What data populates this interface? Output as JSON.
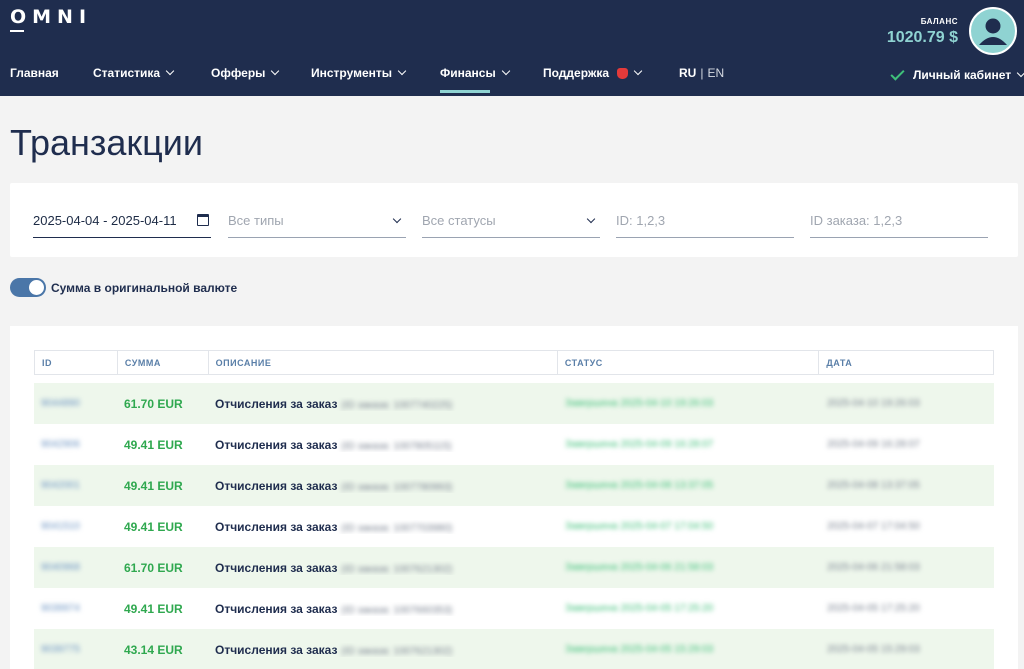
{
  "header": {
    "logo": "OMNI",
    "balance_label": "БАЛАНС",
    "balance_value": "1020.79 $",
    "avatar_icon": "user-icon"
  },
  "nav": {
    "items": [
      {
        "label": "Главная",
        "dropdown": false
      },
      {
        "label": "Статистика",
        "dropdown": true
      },
      {
        "label": "Офферы",
        "dropdown": true
      },
      {
        "label": "Инструменты",
        "dropdown": true
      },
      {
        "label": "Финансы",
        "dropdown": true,
        "active": true
      },
      {
        "label": "Поддержка",
        "dropdown": true,
        "icon": "notification-bell-icon"
      }
    ],
    "lang_ru": "RU",
    "lang_sep": "|",
    "lang_en": "EN",
    "account_label": "Личный кабинет"
  },
  "page": {
    "title": "Транзакции"
  },
  "filters": {
    "date_range": "2025-04-04 - 2025-04-11",
    "type_placeholder": "Все типы",
    "status_placeholder": "Все статусы",
    "id_placeholder": "ID: 1,2,3",
    "order_id_placeholder": "ID заказа: 1,2,3"
  },
  "toggle": {
    "label": "Сумма в оригинальной валюте",
    "on": true
  },
  "table": {
    "headers": [
      "ID",
      "СУММА",
      "ОПИСАНИЕ",
      "СТАТУС",
      "ДАТА"
    ],
    "rows": [
      {
        "id": "9044890",
        "sum": "61.70 EUR",
        "desc": "Отчисления за заказ",
        "desc_extra": "(ID заказа: 1007740225)",
        "status": "Завершена 2025-04-10 19:26:03",
        "date": "2025-04-10 19:26:03"
      },
      {
        "id": "9042906",
        "sum": "49.41 EUR",
        "desc": "Отчисления за заказ",
        "desc_extra": "(ID заказа: 1007805115)",
        "status": "Завершена 2025-04-09 16:28:07",
        "date": "2025-04-09 16:28:07"
      },
      {
        "id": "9042001",
        "sum": "49.41 EUR",
        "desc": "Отчисления за заказ",
        "desc_extra": "(ID заказа: 1007780993)",
        "status": "Завершена 2025-04-08 13:37:05",
        "date": "2025-04-08 13:37:05"
      },
      {
        "id": "9041510",
        "sum": "49.41 EUR",
        "desc": "Отчисления за заказ",
        "desc_extra": "(ID заказа: 1007703980)",
        "status": "Завершена 2025-04-07 17:04:50",
        "date": "2025-04-07 17:04:50"
      },
      {
        "id": "9040968",
        "sum": "61.70 EUR",
        "desc": "Отчисления за заказ",
        "desc_extra": "(ID заказа: 1007621302)",
        "status": "Завершена 2025-04-06 21:58:03",
        "date": "2025-04-06 21:58:03"
      },
      {
        "id": "9039974",
        "sum": "49.41 EUR",
        "desc": "Отчисления за заказ",
        "desc_extra": "(ID заказа: 1007660353)",
        "status": "Завершена 2025-04-05 17:25:20",
        "date": "2025-04-05 17:25:20"
      },
      {
        "id": "9039775",
        "sum": "43.14 EUR",
        "desc": "Отчисления за заказ",
        "desc_extra": "(ID заказа: 1007621302)",
        "status": "Завершена 2025-04-05 15:29:03",
        "date": "2025-04-05 15:29:03"
      }
    ]
  },
  "colors": {
    "header_bg": "#1f2d4e",
    "accent": "#8fd3d2",
    "amount_green": "#2fa84f",
    "row_highlight": "#eef7ec",
    "toggle_blue": "#4a76a8"
  }
}
